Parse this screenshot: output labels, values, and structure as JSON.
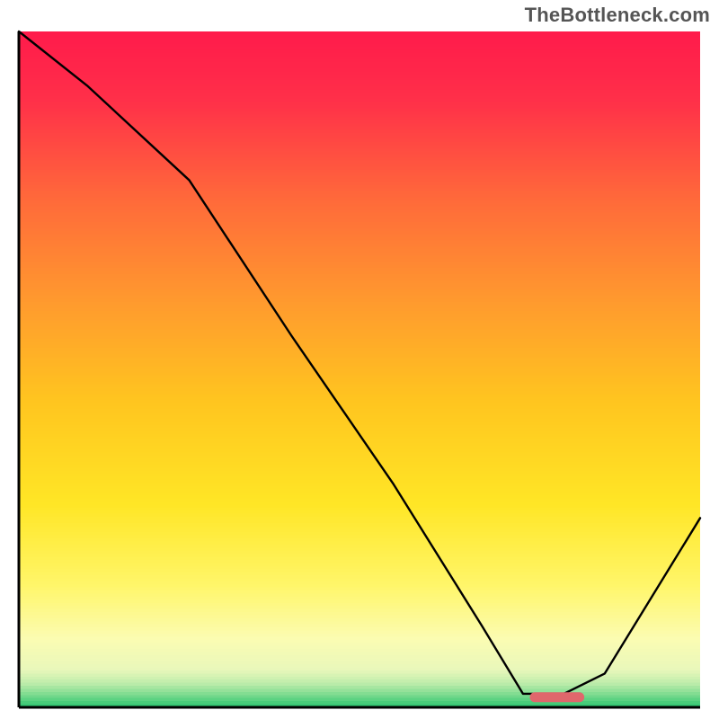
{
  "watermark": "TheBottleneck.com",
  "colors": {
    "axis": "#000000",
    "line": "#000000",
    "marker": "#e0676c"
  },
  "chart_data": {
    "type": "line",
    "title": "",
    "xlabel": "",
    "ylabel": "",
    "xlim": [
      0,
      100
    ],
    "ylim": [
      0,
      100
    ],
    "grid": false,
    "gradient_stops": [
      {
        "offset": 0,
        "color": "#ff1b4b"
      },
      {
        "offset": 0.1,
        "color": "#ff2f49"
      },
      {
        "offset": 0.25,
        "color": "#ff6a3a"
      },
      {
        "offset": 0.4,
        "color": "#ff9a2e"
      },
      {
        "offset": 0.55,
        "color": "#ffc61f"
      },
      {
        "offset": 0.7,
        "color": "#ffe626"
      },
      {
        "offset": 0.82,
        "color": "#fff66a"
      },
      {
        "offset": 0.9,
        "color": "#fbfcb3"
      },
      {
        "offset": 0.945,
        "color": "#e8f7ba"
      },
      {
        "offset": 0.965,
        "color": "#bdecaa"
      },
      {
        "offset": 0.982,
        "color": "#79da8e"
      },
      {
        "offset": 1.0,
        "color": "#2bc36e"
      }
    ],
    "series": [
      {
        "name": "bottleneck-curve",
        "x": [
          0,
          10,
          25,
          40,
          55,
          68,
          74,
          80,
          86,
          100
        ],
        "values": [
          100,
          92,
          78,
          55,
          33,
          12,
          2,
          2,
          5,
          28
        ]
      }
    ],
    "marker": {
      "x_start": 75,
      "x_end": 83,
      "y": 1.5
    }
  }
}
